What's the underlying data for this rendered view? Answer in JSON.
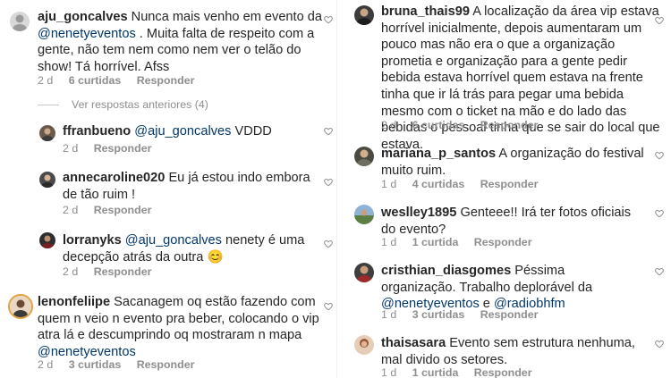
{
  "left_column": {
    "main_comment": {
      "username": "aju_goncalves",
      "text_before": "Nunca mais venho em evento da ",
      "mention": "@nenetyeventos",
      "text_after": " . Muita falta de respeito com a gente, não tem nem como nem ver o telão do show! Tá horrível. Afss",
      "time": "2 d",
      "likes": "6 curtidas",
      "reply_label": "Responder"
    },
    "view_previous_label": "Ver respostas anteriores (4)",
    "replies": [
      {
        "username": "ffranbueno",
        "mention": "@aju_goncalves",
        "text": " VDDD",
        "time": "2 d",
        "reply_label": "Responder"
      },
      {
        "username": "annecaroline020",
        "text": "Eu já estou indo embora de tão ruim !",
        "time": "2 d",
        "reply_label": "Responder"
      },
      {
        "username": "lorranyks",
        "mention": "@aju_goncalves",
        "text": " nenety é uma decepção atrás da outra 😊",
        "time": "2 d",
        "reply_label": "Responder"
      }
    ],
    "last_comment": {
      "username": "lenonfeliipe",
      "text": "Sacanagem oq estão fazendo com quem n veio n evento pra beber, colocando o vip atra lá e descumprindo oq mostraram n mapa ",
      "mention": "@nenetyeventos",
      "time": "2 d",
      "likes": "3 curtidas",
      "reply_label": "Responder"
    }
  },
  "right_column": {
    "comments": [
      {
        "username": "bruna_thais99",
        "text": "A localização da área vip estava horrível inicialmente, depois aumentaram um pouco mas não era o que a organização prometia e organização para a gente pedir bebida estava horrível quem estava na frente tinha que ir lá trás para pegar uma bebida mesmo com o ticket na mão e do lado das bebidas o pessoal tinha que se sair do local que estava.",
        "time": "2 d",
        "likes": "6 curtidas",
        "reply_label": "Responder"
      },
      {
        "username": "mariana_p_santos",
        "text": "A organização do festival muito ruim.",
        "time": "1 d",
        "likes": "4 curtidas",
        "reply_label": "Responder"
      },
      {
        "username": "weslley1895",
        "text": "Genteee!! Irá ter fotos oficiais do evento?",
        "time": "1 d",
        "likes": "1 curtida",
        "reply_label": "Responder"
      },
      {
        "username": "cristhian_diasgomes",
        "text": "Péssima organização. Trabalho deplorável da ",
        "mention": "@nenetyeventos",
        "text_mid": " e ",
        "mention2": "@radiobhfm",
        "time": "1 d",
        "likes": "3 curtidas",
        "reply_label": "Responder"
      },
      {
        "username": "thaisasara",
        "text": "Evento sem estrutura nenhuma, mal divido os setores.",
        "time": "1 d",
        "likes": "1 curtida",
        "reply_label": "Responder"
      }
    ]
  },
  "colors": {
    "text": "#262626",
    "mention": "#00376b",
    "meta": "#8e8e8e"
  }
}
